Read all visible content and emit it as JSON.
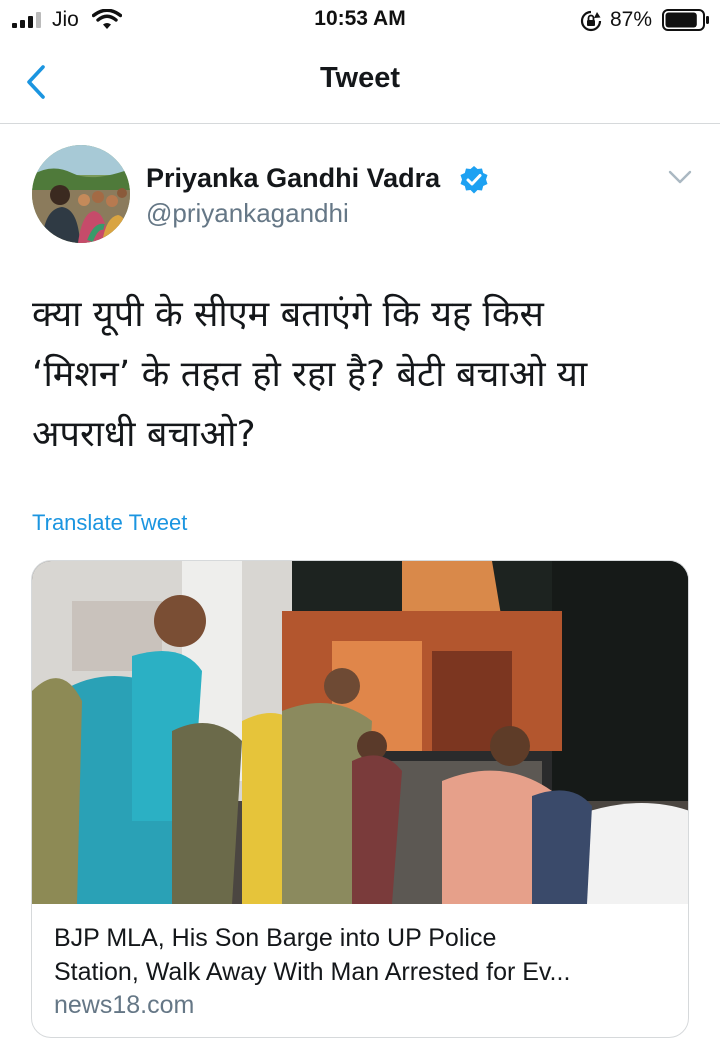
{
  "status_bar": {
    "carrier": "Jio",
    "time": "10:53 AM",
    "battery_percent": "87%",
    "battery_level": 0.87
  },
  "nav": {
    "title": "Tweet"
  },
  "tweet": {
    "author_name": "Priyanka Gandhi Vadra",
    "author_handle": "@priyankagandhi",
    "text_lines": [
      "क्या यूपी के सीएम बताएंगे कि यह किस",
      "‘मिशन’ के तहत हो रहा है? बेटी बचाओ या",
      "अपराधी बचाओ?"
    ],
    "translate_label": "Translate Tweet"
  },
  "card": {
    "title_lines": [
      "BJP MLA, His Son Barge into UP Police",
      "Station, Walk Away With Man Arrested for Ev..."
    ],
    "domain": "news18.com"
  },
  "colors": {
    "link_blue": "#1b95e0",
    "verified_blue": "#1da1f2",
    "secondary_text": "#657786",
    "primary_text": "#14171a",
    "divider": "#d6d9db"
  },
  "icons": {
    "back": "chevron-left-icon",
    "verified": "verified-badge-icon",
    "more": "chevron-down-icon"
  }
}
